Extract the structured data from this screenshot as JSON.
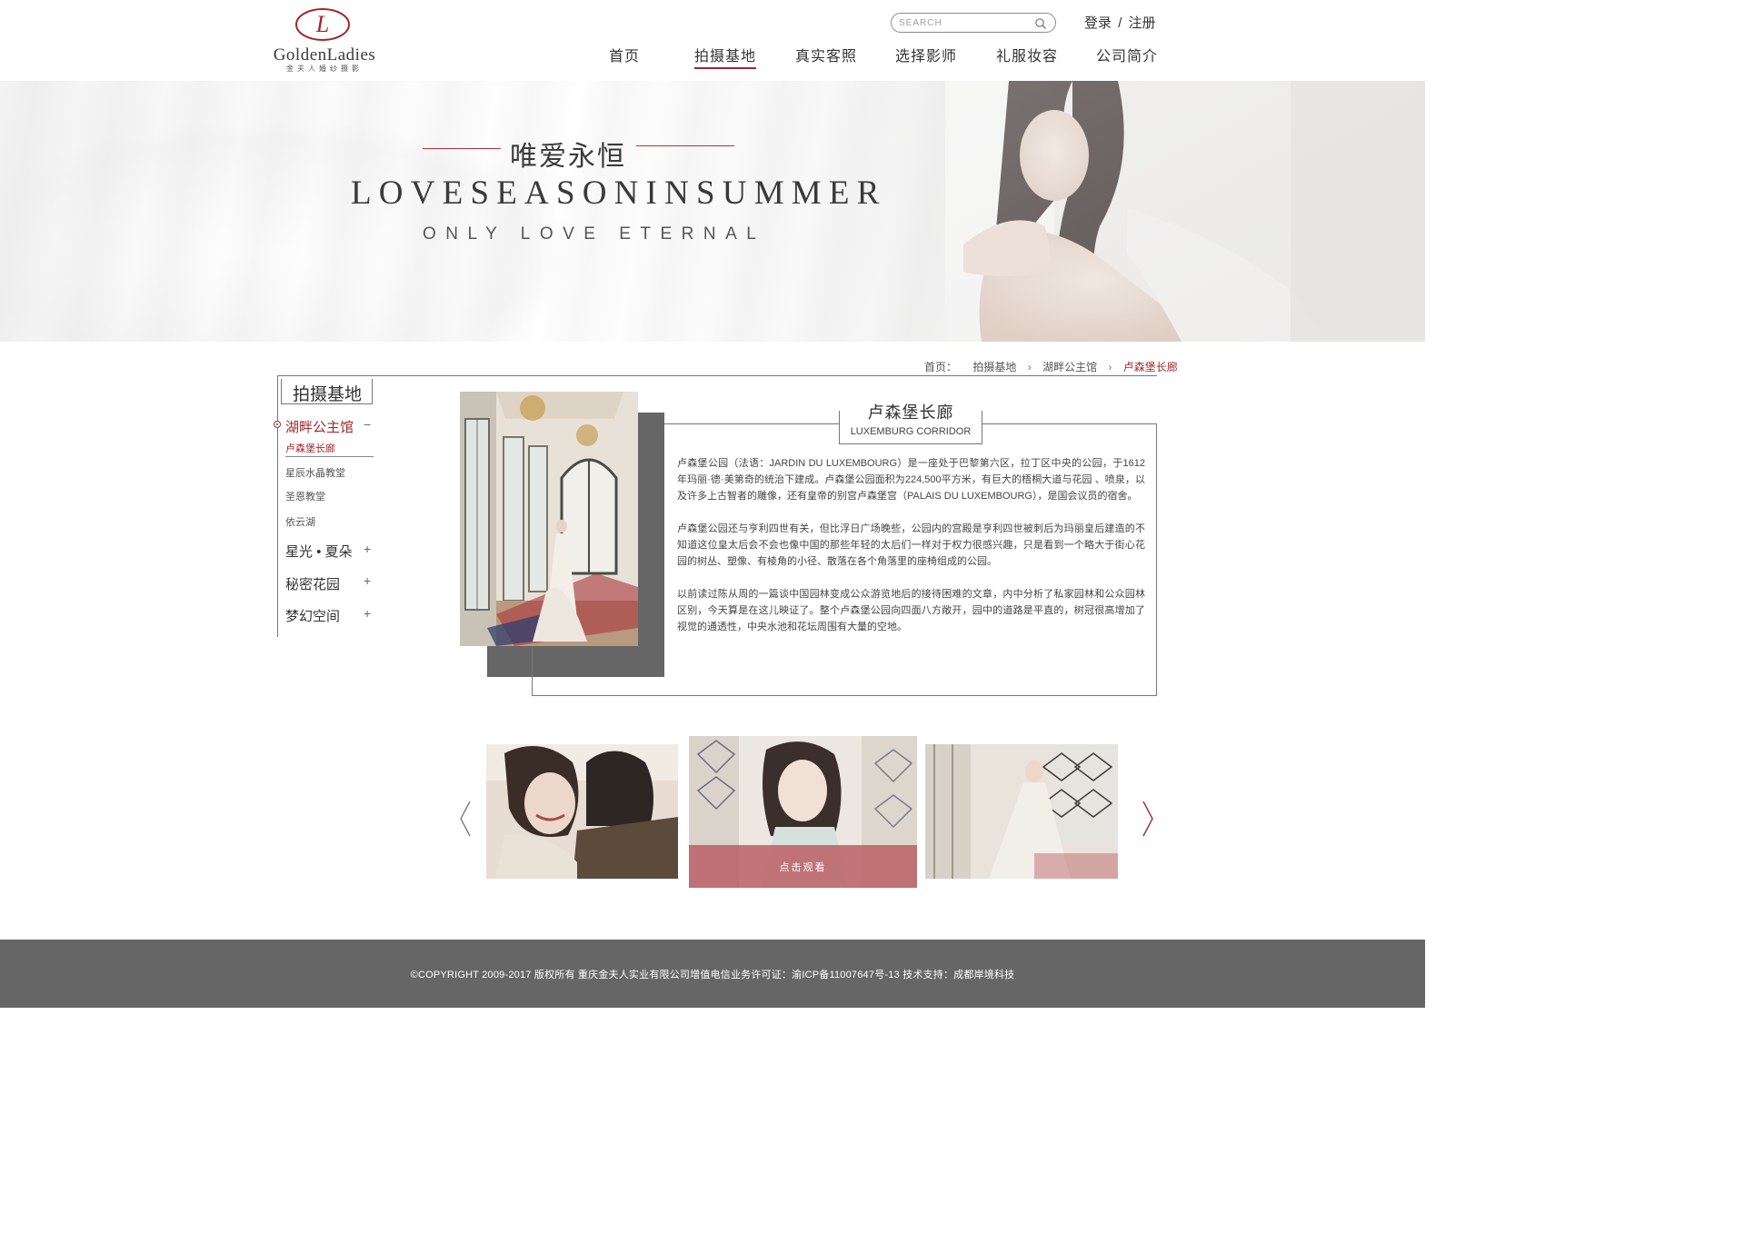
{
  "brand": {
    "logo_letter": "L",
    "name": "GoldenLadies",
    "subtitle": "金夫人婚纱摄影"
  },
  "header": {
    "search_placeholder": "SEARCH",
    "login": "登录",
    "login_sep": "/",
    "register": "注册",
    "nav": [
      {
        "label": "首页",
        "active": false
      },
      {
        "label": "拍摄基地",
        "active": true
      },
      {
        "label": "真实客照",
        "active": false
      },
      {
        "label": "选择影师",
        "active": false
      },
      {
        "label": "礼服妆容",
        "active": false
      },
      {
        "label": "公司简介",
        "active": false
      }
    ]
  },
  "banner": {
    "title": "唯爱永恒",
    "headline": "LOVESEASONINSUMMER",
    "tagline": "ONLY LOVE ETERNAL"
  },
  "breadcrumb": {
    "home": "首页：",
    "items": [
      "拍摄基地",
      "湖畔公主馆",
      "卢森堡长廊"
    ]
  },
  "sidebar": {
    "heading": "拍摄基地",
    "groups": [
      {
        "label": "湖畔公主馆",
        "toggle": "−",
        "active": true,
        "items": [
          {
            "label": "卢森堡长廊",
            "active": true
          },
          {
            "label": "星辰水晶教堂",
            "active": false
          },
          {
            "label": "圣恩教堂",
            "active": false
          },
          {
            "label": "依云湖",
            "active": false
          }
        ]
      },
      {
        "label": "星光 • 夏朵",
        "toggle": "+",
        "active": false
      },
      {
        "label": "秘密花园",
        "toggle": "+",
        "active": false
      },
      {
        "label": "梦幻空间",
        "toggle": "+",
        "active": false
      }
    ]
  },
  "feature": {
    "title": "卢森堡长廊",
    "subtitle": "LUXEMBURG CORRIDOR",
    "paragraphs": [
      "卢森堡公园（法语：JARDIN DU LUXEMBOURG）是一座处于巴黎第六区，拉丁区中央的公园，于1612年玛丽·德·美第奇的统治下建成。卢森堡公园面积为224,500平方米，有巨大的梧桐大道与花园 、喷泉，以及许多上古智者的雕像，还有皇帝的别宫卢森堡宫（PALAIS DU LUXEMBOURG），是国会议员的宿舍。",
      "卢森堡公园还与亨利四世有关，但比浮日广场晚些，公园内的宫殿是亨利四世被刺后为玛丽皇后建造的不知道这位皇太后会不会也像中国的那些年轻的太后们一样对于权力很感兴趣，只是看到一个略大于街心花园的树丛、塑像、有棱角的小径、散落在各个角落里的座椅组成的公园。",
      "以前读过陈从周的一篇谈中国园林变成公众游览地后的接待困难的文章，内中分析了私家园林和公众园林区别，今天算是在这儿映证了。整个卢森堡公园向四面八方敞开，园中的道路是平直的，树冠很高增加了视觉的通透性，中央水池和花坛周围有大量的空地。"
    ]
  },
  "carousel": {
    "overlay_label": "点击观看"
  },
  "footer": {
    "text": "©COPYRIGHT 2009-2017 版权所有 重庆金夫人实业有限公司增值电信业务许可证：渝ICP备11007647号-13  技术支持：成都岸境科技"
  },
  "colors": {
    "accent": "#9e2a2f",
    "footer_bg": "#666666",
    "shadow_block": "#666666"
  }
}
